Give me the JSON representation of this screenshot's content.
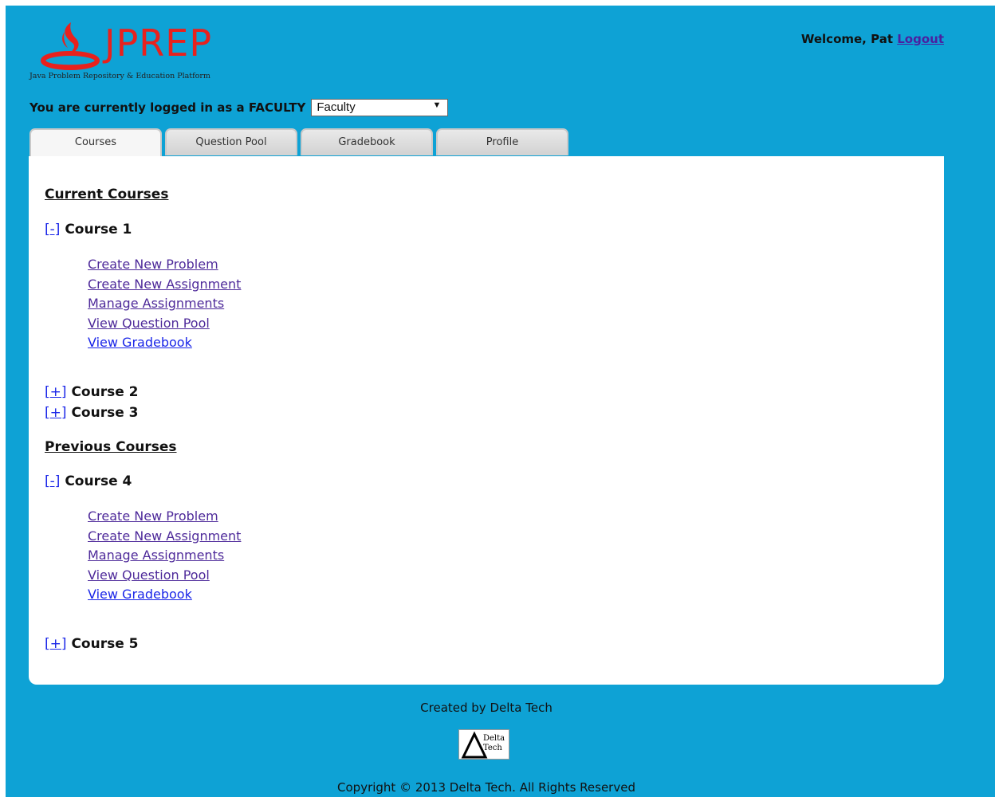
{
  "brand": {
    "name": "JPREP",
    "tagline": "Java Problem Repository & Education Platform"
  },
  "header": {
    "welcome_text": "Welcome, Pat",
    "logout_label": "Logout"
  },
  "role": {
    "prompt": "You are currently logged in as a FACULTY",
    "selected": "Faculty"
  },
  "tabs": [
    {
      "label": "Courses",
      "active": true
    },
    {
      "label": "Question Pool",
      "active": false
    },
    {
      "label": "Gradebook",
      "active": false
    },
    {
      "label": "Profile",
      "active": false
    }
  ],
  "current": {
    "title": "Current Courses",
    "course1": {
      "toggle": "[-]",
      "name": "Course 1",
      "links": [
        "Create New Problem",
        "Create New Assignment",
        "Manage Assignments",
        "View Question Pool",
        "View Gradebook"
      ]
    },
    "course2": {
      "toggle": "[+]",
      "name": "Course 2"
    },
    "course3": {
      "toggle": "[+]",
      "name": "Course 3"
    }
  },
  "previous": {
    "title": "Previous Courses",
    "course4": {
      "toggle": "[-]",
      "name": "Course 4",
      "links": [
        "Create New Problem",
        "Create New Assignment",
        "Manage Assignments",
        "View Question Pool",
        "View Gradebook"
      ]
    },
    "course5": {
      "toggle": "[+]",
      "name": "Course 5"
    }
  },
  "footer": {
    "created_by": "Created by Delta Tech",
    "logo_text_1": "Delta",
    "logo_text_2": "Tech",
    "copyright": "Copyright © 2013 Delta Tech. All Rights Reserved"
  },
  "colors": {
    "page_background": "#0ea2d5",
    "brand_red": "#e8211d",
    "link_visited": "#4e2a9a",
    "link_blue": "#1a26e8"
  }
}
